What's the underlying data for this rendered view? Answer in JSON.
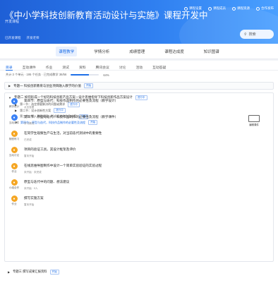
{
  "header": {
    "title": "《中小学科技创新教育活动设计与实施》课程开发中",
    "status": "开发课程",
    "meta": [
      "已开发课程",
      "开发老师"
    ],
    "actions": [
      "课程设置",
      "课程成员",
      "课程资源",
      "合作发布"
    ],
    "search_label": "搜索"
  },
  "nav": [
    "课程教学",
    "学情分析",
    "成绩管理",
    "课程达成度",
    "知识图谱"
  ],
  "subtabs": [
    "目录",
    "互动课件",
    "作业",
    "测试",
    "资料",
    "腾讯会议",
    "讨论",
    "活动",
    "互动答疑"
  ],
  "stats": {
    "text": "共计 3 个单元 · 195 个任务 · 已完成教学 36/56",
    "progress_label": "64%",
    "progress": 0.64
  },
  "chapters": {
    "first": {
      "title": "专题一 科技创新教育与创业项目融入教学的价值",
      "tag": "开始"
    },
    "second": {
      "title": "专题二 如何形成一个好的科技创新产品方案—设计思维指导下科技创新作品方案设计",
      "tag": "进行中"
    },
    "last": {
      "title": "专题三 撰写成果汇报资料",
      "tag": "开始"
    }
  },
  "sections": [
    {
      "title": "第一节：选定想要解决的问题或需求",
      "tag": "进行中",
      "open": false
    },
    {
      "title": "第二节：设计创新性方案",
      "tag": "进行中",
      "open": false
    },
    {
      "title": "第三节：深入开展调研，形成初步的作品方案",
      "tag": "开始",
      "open": false
    },
    {
      "title": "第四节：原型与迭代，科技作品制作的必要性及流程",
      "tag": "开始",
      "open": true
    }
  ],
  "tasks": [
    {
      "icon_label": "教学设计",
      "color": "#3b82f6",
      "title": "第四节：原型与迭代：科技作品制作的必要性及流程（教学设计）",
      "sub": "点击查看",
      "has_thumb": false
    },
    {
      "icon_label": "互动课件",
      "color": "#3b82f6",
      "title": "第四节：原型与迭代：科技作品制作的必要性及流程（教学课件）",
      "sub": "学习情况",
      "has_thumb": true,
      "thumb_label": "编辑课件"
    },
    {
      "icon_label": "随堂练习",
      "color": "#f5a623",
      "title": "在同学生观察生产与生活，对当前迭代测试中的重要性",
      "sub": "已完成",
      "has_thumb": false
    },
    {
      "icon_label": "互动讨论",
      "color": "#f5a623",
      "title": "项目的验证工具，其设计框架及评价",
      "sub": "暂未开始",
      "has_thumb": false
    },
    {
      "icon_label": "作业",
      "color": "#f5a623",
      "title": "在线思维导图制作中设计一个简单实验验证的实验过程",
      "sub": "未开始 · 未完成",
      "has_thumb": false
    },
    {
      "icon_label": "小组合作",
      "color": "#f5a623",
      "title": "原型与迭代中的问题、想法建议",
      "sub": "未开始 · 0人",
      "has_thumb": false
    },
    {
      "icon_label": "作业",
      "color": "#f5a623",
      "title": "撰写实施方案",
      "sub": "暂未开始",
      "has_thumb": false
    }
  ]
}
